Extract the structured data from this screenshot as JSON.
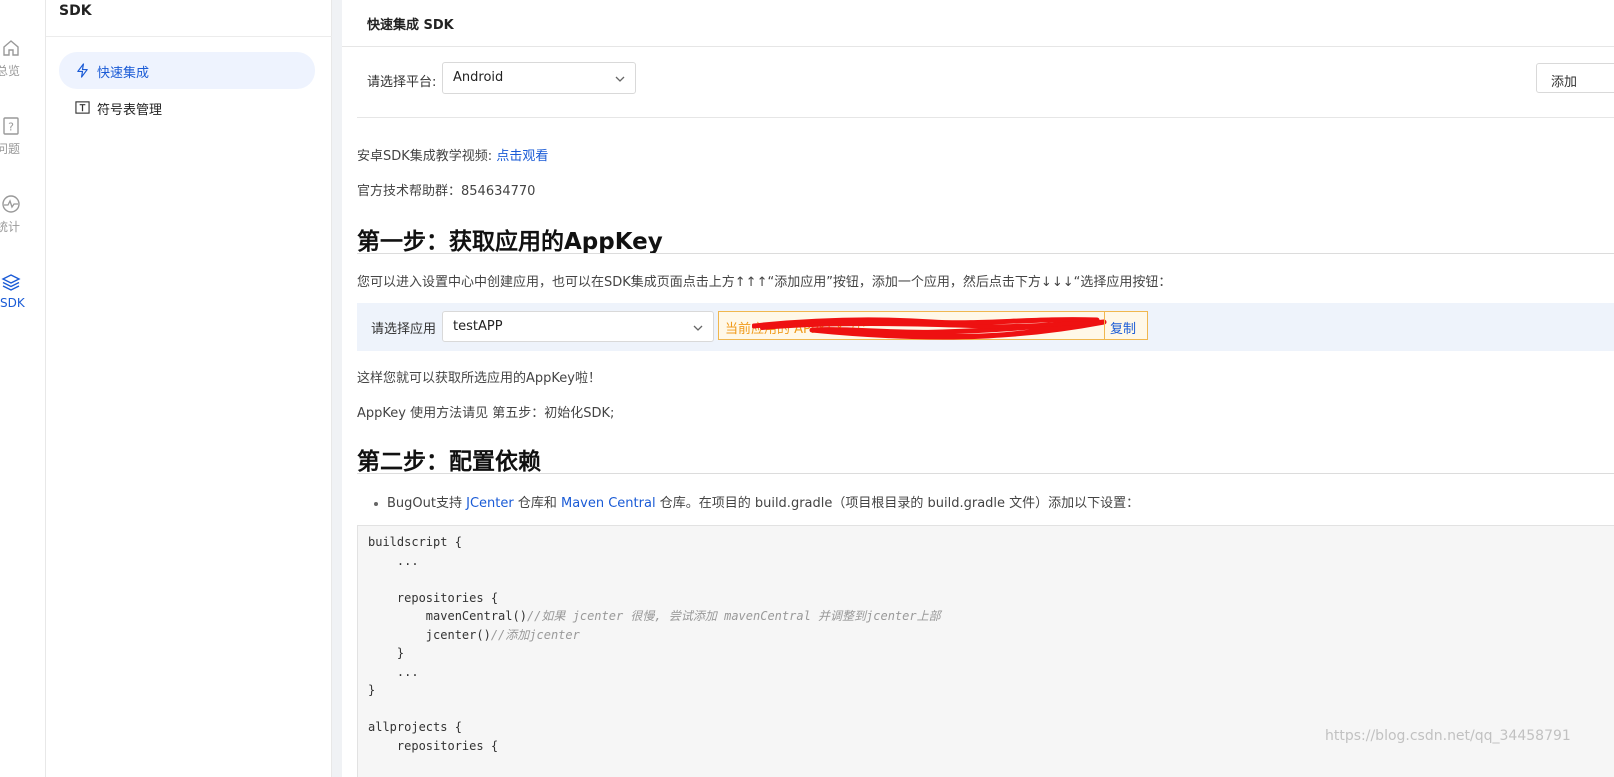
{
  "rail": {
    "items": [
      {
        "label": "总览",
        "icon": "home-icon"
      },
      {
        "label": "问题",
        "icon": "question-icon"
      },
      {
        "label": "统计",
        "icon": "stats-icon"
      },
      {
        "label": "SDK",
        "icon": "layers-icon"
      }
    ]
  },
  "sidebar": {
    "title": "SDK",
    "items": [
      {
        "label": "快速集成",
        "icon": "lightning-icon",
        "active": true
      },
      {
        "label": "符号表管理",
        "icon": "text-box-icon",
        "active": false
      }
    ]
  },
  "main": {
    "title": "快速集成 SDK",
    "platform_label": "请选择平台:",
    "platform_value": "Android",
    "add_app_button": "添加",
    "video_text": "安卓SDK集成教学视频: ",
    "video_link": "点击观看",
    "help_group": "官方技术帮助群：854634770",
    "step1_title": "第一步：获取应用的AppKey",
    "step1_desc": "您可以进入设置中心中创建应用，也可以在SDK集成页面点击上方↑↑↑“添加应用”按钮，添加一个应用，然后点击下方↓↓↓“选择应用按钮：",
    "app_select_label": "请选择应用",
    "app_select_value": "testAPP",
    "appkey_text": "当前应用的 APPKEY 为：",
    "copy_label": "复制",
    "step1_after1": "这样您就可以获取所选应用的AppKey啦！",
    "step1_after2": "AppKey 使用方法请见 第五步：初始化SDK;",
    "step2_title": "第二步：配置依赖",
    "step2_bullet_a": "BugOut支持 ",
    "step2_link_jcenter": "JCenter",
    "step2_bullet_b": " 仓库和 ",
    "step2_link_maven": "Maven Central",
    "step2_bullet_c": " 仓库。在项目的 build.gradle（项目根目录的 build.gradle 文件）添加以下设置：",
    "code": {
      "l1": "buildscript {",
      "l2": "    ...",
      "l4": "    repositories {",
      "l5": "        mavenCentral()",
      "l5c": "//如果 jcenter 很慢, 尝试添加 mavenCentral 并调整到jcenter上部",
      "l6": "        jcenter()",
      "l6c": "//添加jcenter",
      "l7": "    }",
      "l8": "    ...",
      "l9": "}",
      "l11": "allprojects {",
      "l12": "    repositories {"
    }
  },
  "watermark": "https://blog.csdn.net/qq_34458791",
  "colors": {
    "accent": "#1a5bd6",
    "warning": "#f09a1a",
    "redaction": "#ee1111"
  }
}
